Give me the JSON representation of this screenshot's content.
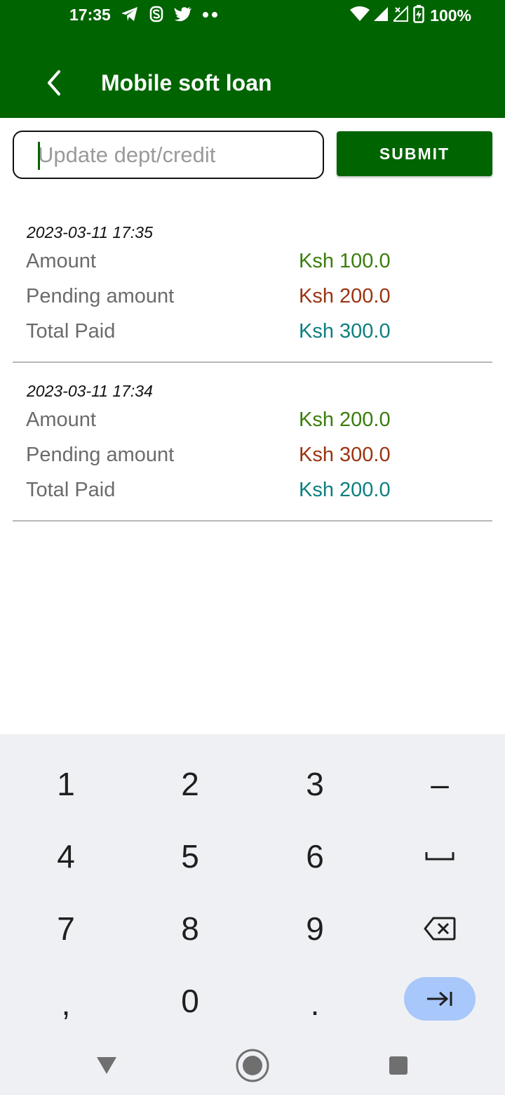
{
  "status_bar": {
    "time": "17:35",
    "battery": "100%",
    "left_icons": [
      "telegram-icon",
      "app-s-icon",
      "twitter-icon",
      "more-dots-icon"
    ],
    "right_icons": [
      "wifi-icon",
      "signal-icon",
      "signal-no-data-icon",
      "battery-charging-icon"
    ]
  },
  "app_bar": {
    "title": "Mobile soft loan",
    "back_icon": "back-arrow-icon",
    "color": "#006400"
  },
  "form": {
    "input_placeholder": "Update dept/credit",
    "input_value": "",
    "submit_label": "SUBMIT"
  },
  "records": [
    {
      "date": "2023-03-11 17:35",
      "rows": [
        {
          "label": "Amount",
          "value": "Ksh 100.0"
        },
        {
          "label": "Pending amount",
          "value": "Ksh 200.0"
        },
        {
          "label": "Total Paid",
          "value": "Ksh 300.0"
        }
      ]
    },
    {
      "date": "2023-03-11 17:34",
      "rows": [
        {
          "label": "Amount",
          "value": "Ksh 200.0"
        },
        {
          "label": "Pending amount",
          "value": "Ksh 300.0"
        },
        {
          "label": "Total Paid",
          "value": "Ksh 200.0"
        }
      ]
    }
  ],
  "colors": {
    "amount": "#3a7d0c",
    "pending": "#9a3412",
    "paid": "#0e7f7f"
  },
  "keyboard": {
    "rows": [
      [
        "1",
        "2",
        "3",
        "–"
      ],
      [
        "4",
        "5",
        "6",
        "space-icon"
      ],
      [
        "7",
        "8",
        "9",
        "backspace-icon"
      ],
      [
        ",",
        "0",
        ".",
        "enter-tab-icon"
      ]
    ]
  },
  "nav_bar": {
    "buttons": [
      "back-triangle-icon",
      "home-circle-icon",
      "recents-square-icon"
    ]
  }
}
